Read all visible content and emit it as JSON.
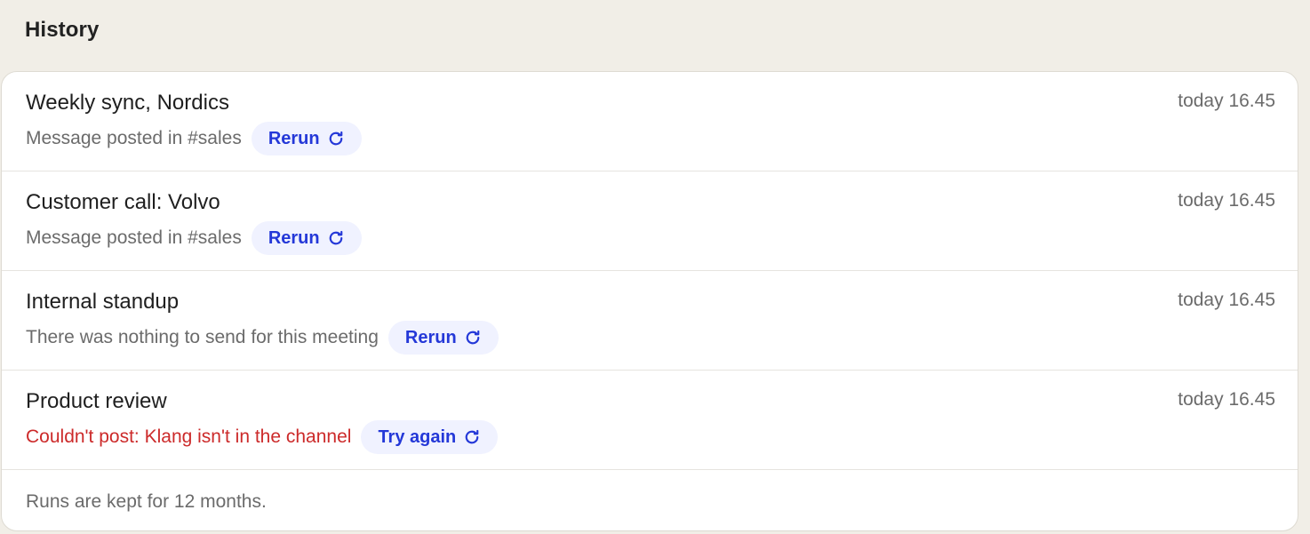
{
  "header": {
    "title": "History"
  },
  "runs": [
    {
      "title": "Weekly sync, Nordics",
      "status": "Message posted in #sales",
      "status_type": "ok",
      "action_label": "Rerun",
      "time": "today 16.45"
    },
    {
      "title": "Customer call: Volvo",
      "status": "Message posted in #sales",
      "status_type": "ok",
      "action_label": "Rerun",
      "time": "today 16.45"
    },
    {
      "title": "Internal standup",
      "status": "There was nothing to send for this meeting",
      "status_type": "ok",
      "action_label": "Rerun",
      "time": "today 16.45"
    },
    {
      "title": "Product review",
      "status": "Couldn't post: Klang isn't in the channel",
      "status_type": "error",
      "action_label": "Try again",
      "time": "today 16.45"
    }
  ],
  "footer": {
    "note": "Runs are kept for 12 months."
  },
  "icons": {
    "action": "refresh-icon"
  },
  "colors": {
    "background": "#f1eee7",
    "card": "#ffffff",
    "accent": "#2438d8",
    "accent_bg": "#f0f2ff",
    "error": "#cc2a2a",
    "muted": "#6b6b6b"
  }
}
